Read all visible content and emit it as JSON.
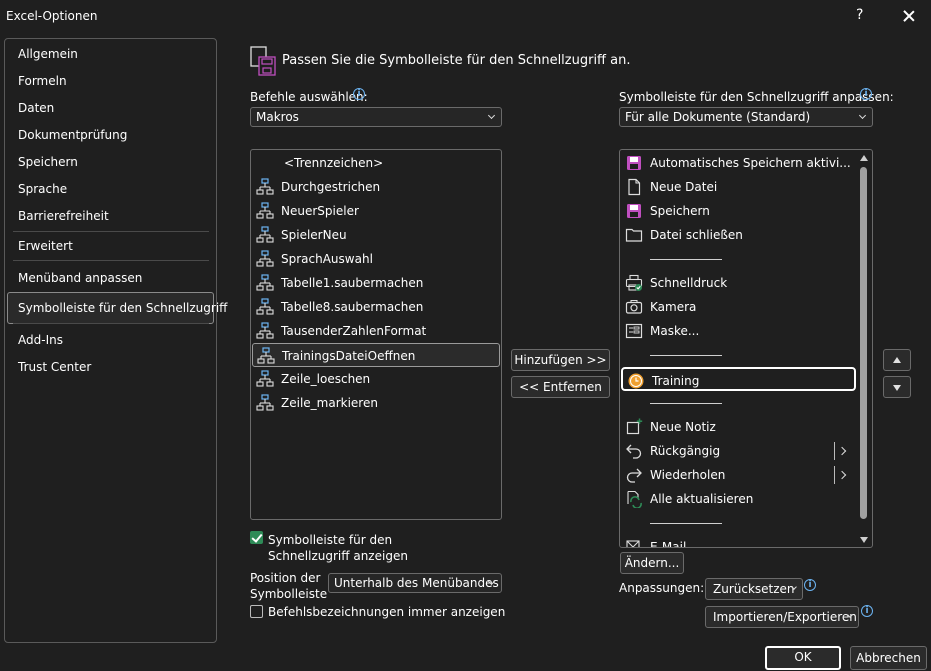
{
  "window": {
    "title": "Excel-Optionen",
    "help_label": "?"
  },
  "nav": {
    "items": [
      "Allgemein",
      "Formeln",
      "Daten",
      "Dokumentprüfung",
      "Speichern",
      "Sprache",
      "Barrierefreiheit",
      "Erweitert",
      "Menüband anpassen",
      "Symbolleiste für den Schnellzugriff",
      "Add-Ins",
      "Trust Center"
    ],
    "selected": "Symbolleiste für den Schnellzugriff"
  },
  "heading": "Passen Sie die Symbolleiste für den Schnellzugriff an.",
  "left": {
    "label": "Befehle auswählen:",
    "select_value": "Makros",
    "items": [
      {
        "label": "<Trennzeichen>",
        "icon": "none"
      },
      {
        "label": "Durchgestrichen",
        "icon": "macro-icon"
      },
      {
        "label": "NeuerSpieler",
        "icon": "macro-icon"
      },
      {
        "label": "SpielerNeu",
        "icon": "macro-icon"
      },
      {
        "label": "SprachAuswahl",
        "icon": "macro-icon"
      },
      {
        "label": "Tabelle1.saubermachen",
        "icon": "macro-icon"
      },
      {
        "label": "Tabelle8.saubermachen",
        "icon": "macro-icon"
      },
      {
        "label": "TausenderZahlenFormat",
        "icon": "macro-icon"
      },
      {
        "label": "TrainingsDateiOeffnen",
        "icon": "macro-icon",
        "selected": true
      },
      {
        "label": "Zeile_loeschen",
        "icon": "macro-icon"
      },
      {
        "label": "Zeile_markieren",
        "icon": "macro-icon"
      }
    ]
  },
  "middle": {
    "add_label": "Hinzufügen >>",
    "remove_label": "<< Entfernen"
  },
  "right": {
    "label": "Symbolleiste für den Schnellzugriff anpassen:",
    "select_value": "Für alle Dokumente (Standard)",
    "items": [
      {
        "label": "Automatisches Speichern aktivi...",
        "icon": "save-purple-icon"
      },
      {
        "label": "Neue Datei",
        "icon": "new-file-icon"
      },
      {
        "label": "Speichern",
        "icon": "save-purple-icon"
      },
      {
        "label": "Datei schließen",
        "icon": "folder-icon"
      },
      {
        "label": "",
        "icon": "separator"
      },
      {
        "label": "Schnelldruck",
        "icon": "quick-print-icon"
      },
      {
        "label": "Kamera",
        "icon": "camera-icon"
      },
      {
        "label": "Maske...",
        "icon": "form-icon"
      },
      {
        "label": "",
        "icon": "separator"
      },
      {
        "label": "Training",
        "icon": "clock-icon",
        "selected": true
      },
      {
        "label": "",
        "icon": "separator"
      },
      {
        "label": "Neue Notiz",
        "icon": "new-note-icon"
      },
      {
        "label": "Rückgängig",
        "icon": "undo-icon",
        "submenu": true
      },
      {
        "label": "Wiederholen",
        "icon": "redo-icon",
        "submenu": true
      },
      {
        "label": "Alle aktualisieren",
        "icon": "refresh-all-icon"
      },
      {
        "label": "",
        "icon": "separator"
      },
      {
        "label": "E-Mail",
        "icon": "email-icon"
      }
    ],
    "modify_label": "Ändern...",
    "customizations_label": "Anpassungen:",
    "reset_label": "Zurücksetzen",
    "import_export_label": "Importieren/Exportieren"
  },
  "options": {
    "show_qat_label": "Symbolleiste für den Schnellzugriff anzeigen",
    "show_qat_checked": true,
    "position_label": "Position der Symbolleiste",
    "position_value": "Unterhalb des Menübandes",
    "always_show_labels": "Befehlsbezeichnungen immer anzeigen",
    "always_show_checked": false
  },
  "footer": {
    "ok_label": "OK",
    "cancel_label": "Abbrechen"
  },
  "colors": {
    "background": "#1f1f1f",
    "accent_green": "#2e8b57",
    "info_blue": "#6cb4f2",
    "purple": "#c04fc0"
  }
}
